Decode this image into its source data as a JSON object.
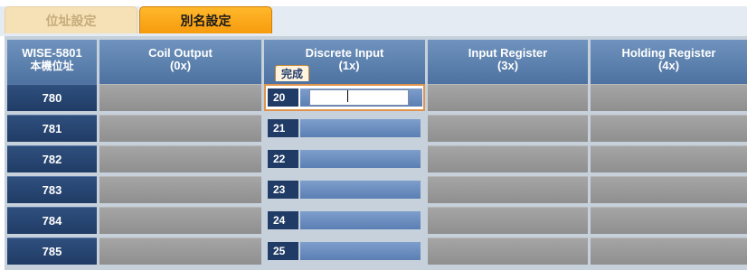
{
  "tabs": [
    {
      "label": "位址設定",
      "active": false
    },
    {
      "label": "別名設定",
      "active": true
    }
  ],
  "headers": {
    "device": {
      "line1": "WISE-5801",
      "line2": "本機位址"
    },
    "coil": {
      "line1": "Coil Output",
      "line2": "(0x)"
    },
    "discrete": {
      "line1": "Discrete Input",
      "line2": "(1x)"
    },
    "input_reg": {
      "line1": "Input Register",
      "line2": "(3x)"
    },
    "holding_reg": {
      "line1": "Holding Register",
      "line2": "(4x)"
    }
  },
  "done_button": "完成",
  "rows": [
    {
      "address": "780",
      "di_index": "20",
      "di_value": ""
    },
    {
      "address": "781",
      "di_index": "21",
      "di_value": ""
    },
    {
      "address": "782",
      "di_index": "22",
      "di_value": ""
    },
    {
      "address": "783",
      "di_index": "23",
      "di_value": ""
    },
    {
      "address": "784",
      "di_index": "24",
      "di_value": ""
    },
    {
      "address": "785",
      "di_index": "25",
      "di_value": ""
    }
  ],
  "colors": {
    "active_tab": "#f79b0e",
    "header": "#4d71a0",
    "row_label": "#203c66",
    "cell": "#999999"
  }
}
